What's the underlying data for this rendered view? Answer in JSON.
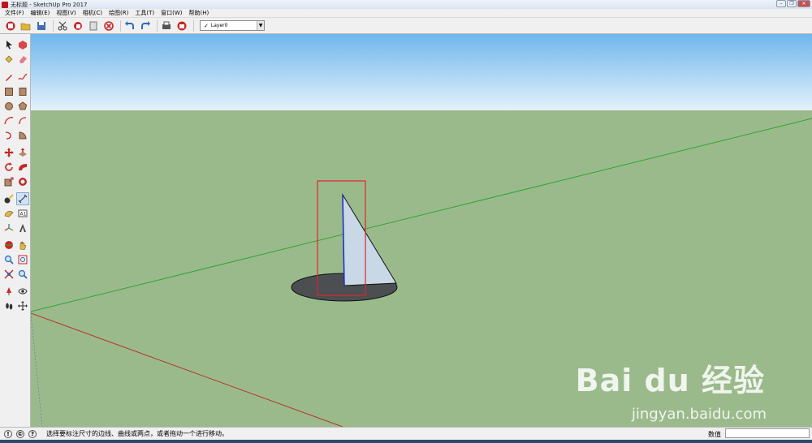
{
  "window": {
    "title": "无标题 - SketchUp Pro 2017"
  },
  "menu": {
    "items": [
      "文件(F)",
      "编辑(E)",
      "视图(V)",
      "相机(C)",
      "绘图(R)",
      "工具(T)",
      "窗口(W)",
      "帮助(H)"
    ]
  },
  "toolbar": {
    "layer_check": "✓",
    "layer_value": "Layer0"
  },
  "left_toolbar": {
    "active_tool": "dimension-tool"
  },
  "status": {
    "hint": "选择要标注尺寸的边线、曲线或两点，或者拖动一个进行移动。",
    "measure_label": "数值",
    "measure_value": ""
  },
  "watermark": {
    "logo": "Bai du 经验",
    "url": "jingyan.baidu.com"
  },
  "colors": {
    "sky_top": "#6eb7ec",
    "sky_bottom": "#e4f1fb",
    "ground": "#9bba8c",
    "green_axis": "#2fa62f",
    "red_axis": "#b4342c",
    "shadow": "#4b4f52",
    "face": "#c8d8e6",
    "selection": "#e0252a"
  }
}
